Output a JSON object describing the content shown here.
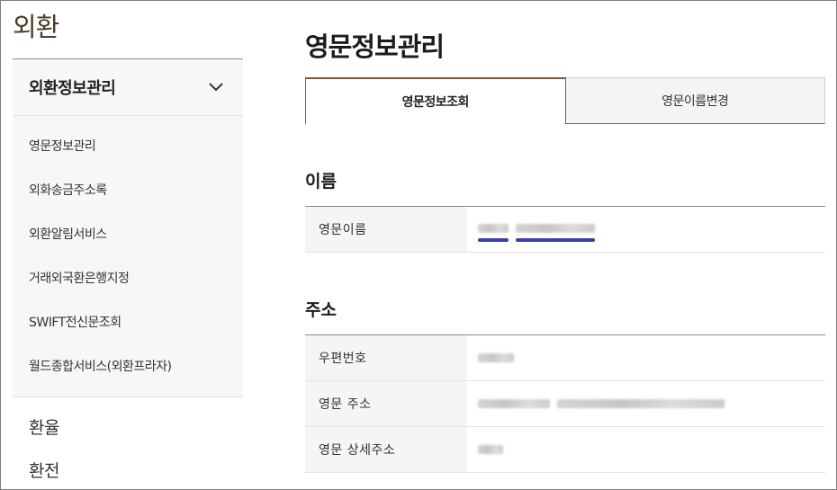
{
  "nav": {
    "title": "외환",
    "group_label": "외환정보관리",
    "sub_items": [
      "영문정보관리",
      "외화송금주소록",
      "외환알림서비스",
      "거래외국환은행지정",
      "SWIFT전신문조회",
      "월드종합서비스(외환프라자)"
    ],
    "plain_items": [
      "환율",
      "환전"
    ]
  },
  "main": {
    "page_title": "영문정보관리",
    "tabs": [
      {
        "label": "영문정보조회",
        "active": true
      },
      {
        "label": "영문이름변경",
        "active": false
      }
    ],
    "name_section": {
      "title": "이름",
      "rows": [
        {
          "label": "영문이름"
        }
      ]
    },
    "address_section": {
      "title": "주소",
      "rows": [
        {
          "label": "우편번호"
        },
        {
          "label": "영문 주소"
        },
        {
          "label": "영문 상세주소"
        }
      ]
    }
  },
  "colors": {
    "accent_brown": "#7b5a3a",
    "underline_blue": "#3a3fb0"
  }
}
